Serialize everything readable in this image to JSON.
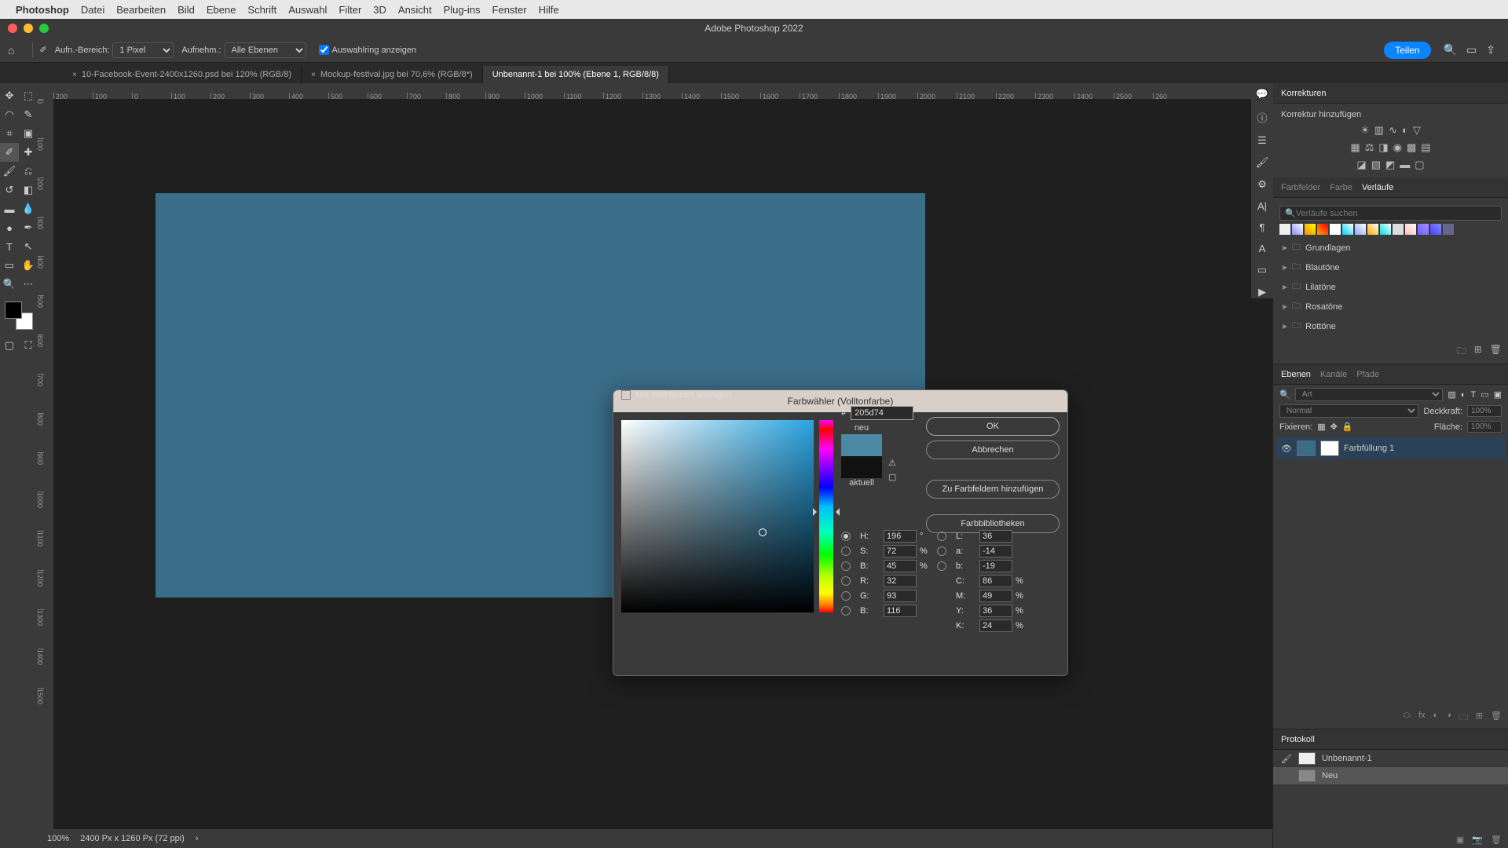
{
  "menubar": {
    "app": "Photoshop",
    "items": [
      "Datei",
      "Bearbeiten",
      "Bild",
      "Ebene",
      "Schrift",
      "Auswahl",
      "Filter",
      "3D",
      "Ansicht",
      "Plug-ins",
      "Fenster",
      "Hilfe"
    ]
  },
  "titlebar": "Adobe Photoshop 2022",
  "options": {
    "range_label": "Aufn.-Bereich:",
    "range_value": "1 Pixel",
    "sample_label": "Aufnehm.:",
    "sample_value": "Alle Ebenen",
    "ring_label": "Auswahlring anzeigen",
    "share": "Teilen"
  },
  "tabs": [
    {
      "label": "10-Facebook-Event-2400x1260.psd bei 120% (RGB/8)",
      "active": false
    },
    {
      "label": "Mockup-festival.jpg bei 70,6% (RGB/8*)",
      "active": false
    },
    {
      "label": "Unbenannt-1 bei 100% (Ebene 1, RGB/8/8)",
      "active": true
    }
  ],
  "ruler_ticks": [
    "200",
    "100",
    "0",
    "100",
    "200",
    "300",
    "400",
    "500",
    "600",
    "700",
    "800",
    "900",
    "1000",
    "1100",
    "1200",
    "1300",
    "1400",
    "1500",
    "1600",
    "1700",
    "1800",
    "1900",
    "2000",
    "2100",
    "2200",
    "2300",
    "2400",
    "2500",
    "260"
  ],
  "status": {
    "zoom": "100%",
    "doc": "2400 Px x 1260 Px (72 ppi)"
  },
  "adjustments": {
    "title": "Korrekturen",
    "add": "Korrektur hinzufügen"
  },
  "gradients": {
    "tabs": [
      "Farbfelder",
      "Farbe",
      "Verläufe"
    ],
    "search_ph": "Verläufe suchen",
    "folders": [
      "Grundlagen",
      "Blautöne",
      "Lilatöne",
      "Rosatöne",
      "Rottöne"
    ]
  },
  "layers": {
    "tabs": [
      "Ebenen",
      "Kanäle",
      "Pfade"
    ],
    "kind": "Art",
    "blend": "Normal",
    "opacity_label": "Deckkraft:",
    "opacity": "100%",
    "lock_label": "Fixieren:",
    "fill_label": "Fläche:",
    "fill": "100%",
    "layer_name": "Farbfüllung 1"
  },
  "history": {
    "title": "Protokoll",
    "items": [
      "Unbenannt-1",
      "Neu"
    ]
  },
  "colorpicker": {
    "title": "Farbwähler (Volltonfarbe)",
    "new": "neu",
    "current": "aktuell",
    "ok": "OK",
    "cancel": "Abbrechen",
    "add_swatch": "Zu Farbfeldern hinzufügen",
    "libraries": "Farbbibliotheken",
    "H": "196",
    "S": "72",
    "Bv": "45",
    "L": "36",
    "a": "-14",
    "b": "-19",
    "R": "32",
    "G": "93",
    "Bb": "116",
    "C": "86",
    "M": "49",
    "Y": "36",
    "K": "24",
    "hex": "205d74",
    "web": "Nur Webfarben anzeigen",
    "deg": "°",
    "pct": "%"
  }
}
